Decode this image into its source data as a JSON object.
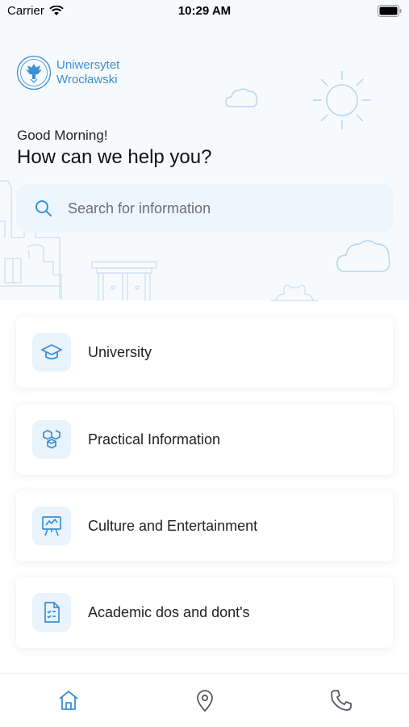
{
  "status_bar": {
    "carrier": "Carrier",
    "time": "10:29 AM"
  },
  "logo": {
    "line1": "Uniwersytet",
    "line2": "Wrocławski"
  },
  "greeting": "Good Morning!",
  "headline": "How can we help you?",
  "search": {
    "placeholder": "Search for information",
    "icon": "search-icon"
  },
  "menu": [
    {
      "label": "University",
      "icon": "graduation-cap-icon"
    },
    {
      "label": "Practical Information",
      "icon": "boxes-icon"
    },
    {
      "label": "Culture and Entertainment",
      "icon": "easel-icon"
    },
    {
      "label": "Academic dos and dont's",
      "icon": "checklist-icon"
    }
  ],
  "tabs": [
    {
      "icon": "home-icon",
      "active": true
    },
    {
      "icon": "location-pin-icon",
      "active": false
    },
    {
      "icon": "phone-icon",
      "active": false
    }
  ],
  "colors": {
    "accent": "#3b8fd3",
    "hero_bg": "#f7fafd",
    "icon_bg": "#e9f3fc",
    "search_bg": "#eef6fd"
  }
}
